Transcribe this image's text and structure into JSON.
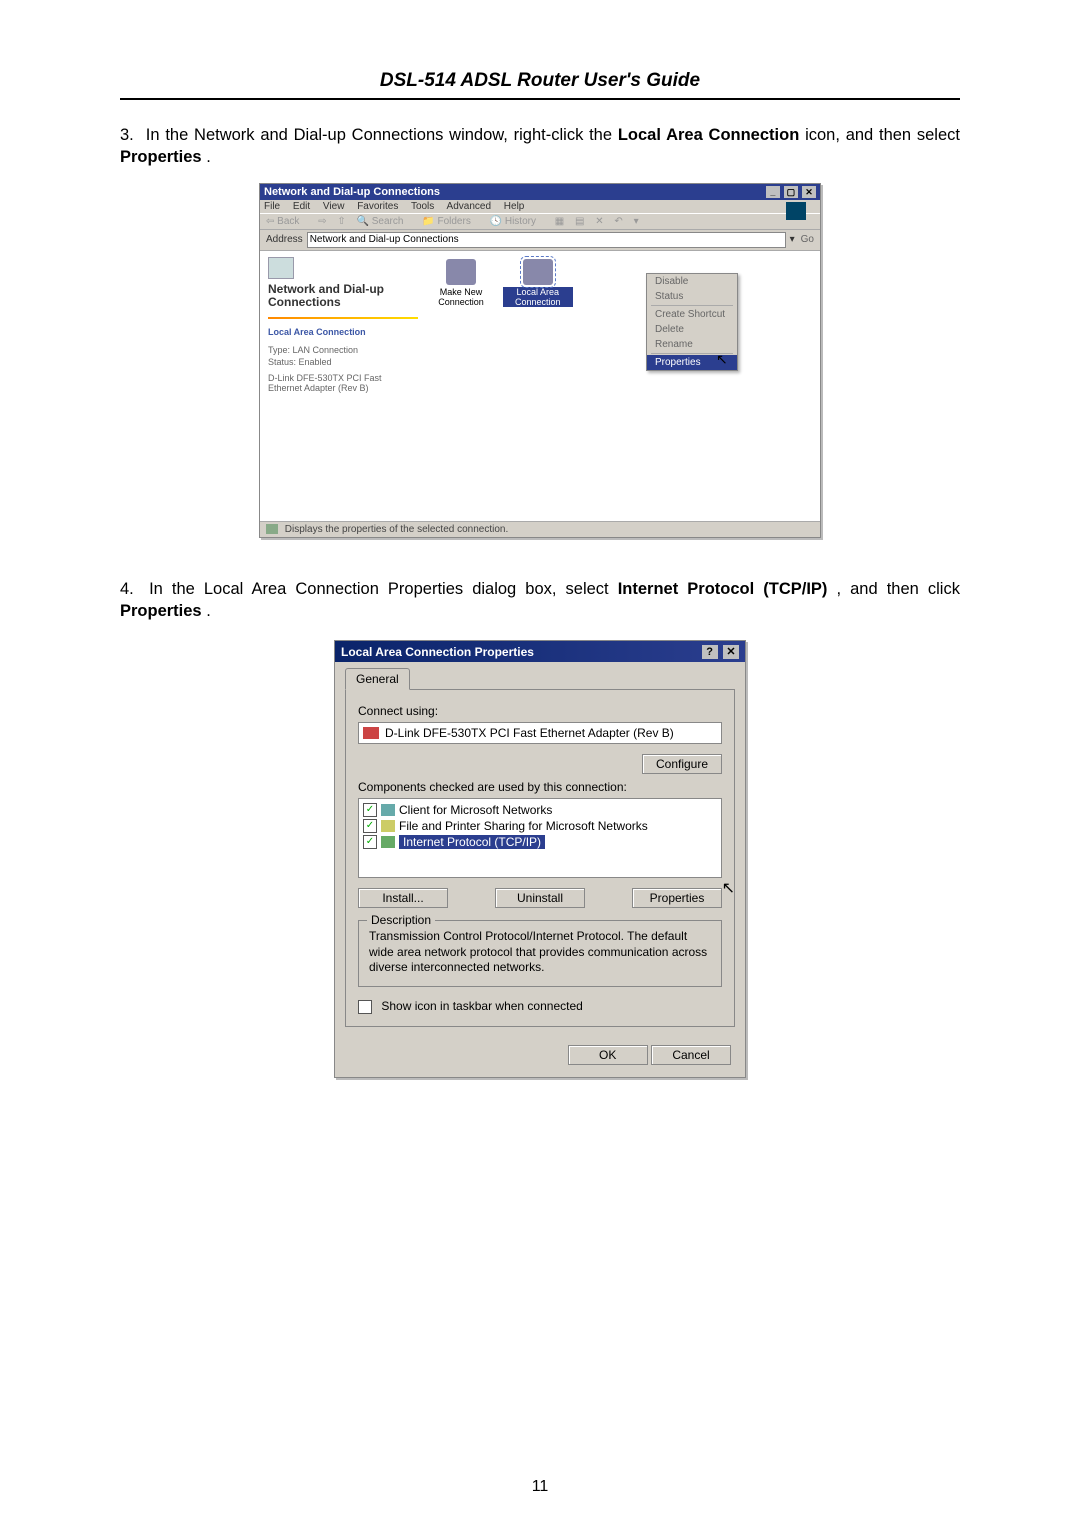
{
  "doc_title": "DSL-514 ADSL Router User's Guide",
  "page_number": "11",
  "step3": {
    "num": "3.",
    "t1": "In the Network and Dial-up Connections window, right-click the ",
    "b1": "Local Area Connection",
    "t2": " icon, and then select ",
    "b2": "Properties",
    "t3": "."
  },
  "step4": {
    "num": "4.",
    "t1": "In the Local Area Connection Properties dialog box, select ",
    "b1": "Internet Protocol (TCP/IP)",
    "t2": ", and then click ",
    "b2": "Properties",
    "t3": "."
  },
  "win1": {
    "title": "Network and Dial-up Connections",
    "menu": [
      "File",
      "Edit",
      "View",
      "Favorites",
      "Tools",
      "Advanced",
      "Help"
    ],
    "tb_back": "Back",
    "tb_search": "Search",
    "tb_folders": "Folders",
    "tb_history": "History",
    "addr_label": "Address",
    "addr_value": "Network and Dial-up Connections",
    "addr_go": "Go",
    "side_heading": "Network and Dial-up Connections",
    "side_link": "Local Area Connection",
    "side_type_lbl": "Type: LAN Connection",
    "side_status_lbl": "Status: Enabled",
    "side_device": "D-Link DFE-530TX PCI Fast Ethernet Adapter (Rev B)",
    "icon1_caption": "Make New Connection",
    "icon2_caption": "Local Area Connection",
    "context_items": [
      "Disable",
      "Status",
      "",
      "Create Shortcut",
      "Delete",
      "Rename",
      "",
      "Properties"
    ],
    "statusbar": "Displays the properties of the selected connection."
  },
  "dlg": {
    "title": "Local Area Connection Properties",
    "tab": "General",
    "connect_using": "Connect using:",
    "adapter": "D-Link DFE-530TX PCI Fast Ethernet Adapter (Rev B)",
    "configure_btn": "Configure",
    "components_lbl": "Components checked are used by this connection:",
    "items": [
      "Client for Microsoft Networks",
      "File and Printer Sharing for Microsoft Networks",
      "Internet Protocol (TCP/IP)"
    ],
    "install_btn": "Install...",
    "uninstall_btn": "Uninstall",
    "properties_btn": "Properties",
    "desc_legend": "Description",
    "desc_text": "Transmission Control Protocol/Internet Protocol. The default wide area network protocol that provides communication across diverse interconnected networks.",
    "show_icon": "Show icon in taskbar when connected",
    "ok_btn": "OK",
    "cancel_btn": "Cancel"
  }
}
